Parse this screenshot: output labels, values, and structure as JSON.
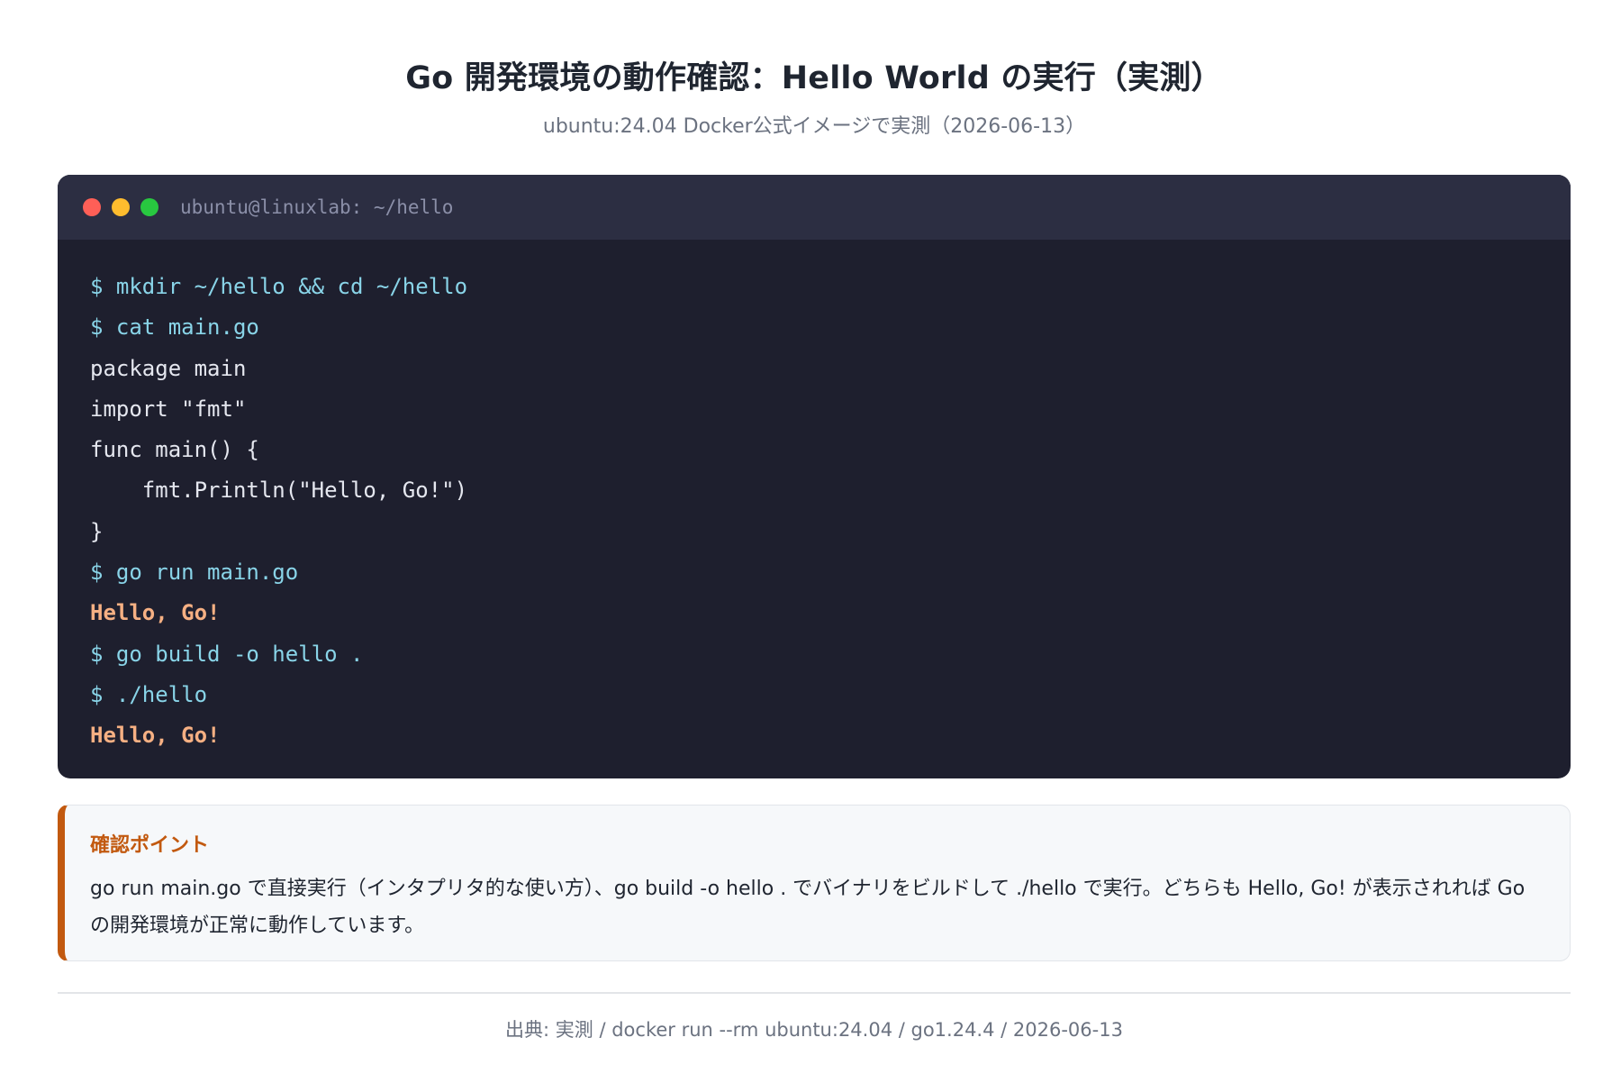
{
  "header": {
    "title": "Go 開発環境の動作確認：Hello World の実行（実測）",
    "subtitle": "ubuntu:24.04 Docker公式イメージで実測（2026-06-13）"
  },
  "terminal": {
    "title": "ubuntu@linuxlab: ~/hello",
    "lines": [
      {
        "kind": "cmd",
        "text": "$ mkdir ~/hello && cd ~/hello"
      },
      {
        "kind": "cmd",
        "text": "$ cat main.go"
      },
      {
        "kind": "code",
        "text": "package main"
      },
      {
        "kind": "code",
        "text": "import \"fmt\""
      },
      {
        "kind": "code",
        "text": "func main() {"
      },
      {
        "kind": "code",
        "text": "    fmt.Println(\"Hello, Go!\")"
      },
      {
        "kind": "code",
        "text": "}"
      },
      {
        "kind": "cmd",
        "text": "$ go run main.go"
      },
      {
        "kind": "out",
        "text": "Hello, Go!"
      },
      {
        "kind": "cmd",
        "text": "$ go build -o hello ."
      },
      {
        "kind": "cmd",
        "text": "$ ./hello"
      },
      {
        "kind": "out",
        "text": "Hello, Go!"
      }
    ]
  },
  "note": {
    "heading": "確認ポイント",
    "body": "go run main.go で直接実行（インタプリタ的な使い方）、go build -o hello . でバイナリをビルドして ./hello で実行。どちらも Hello, Go! が表示されれば Go の開発環境が正常に動作しています。"
  },
  "footer": {
    "source": "出典: 実測 / docker run --rm ubuntu:24.04 / go1.24.4 / 2026-06-13"
  },
  "colors": {
    "terminal_bg": "#1e1f2e",
    "terminal_bar": "#2c2e42",
    "command": "#89d4e8",
    "output": "#f6b083",
    "accent": "#c2590f"
  }
}
